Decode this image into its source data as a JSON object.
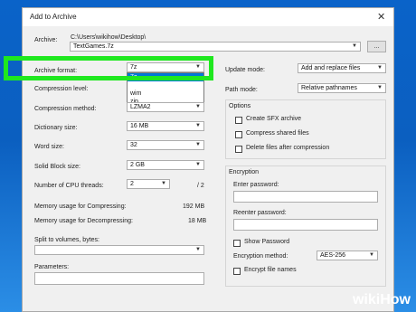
{
  "window": {
    "title": "Add to Archive",
    "close": "✕"
  },
  "archive": {
    "label": "Archive:",
    "path": "C:\\Users\\wikihow\\Desktop\\",
    "filename": "TextGames.7z",
    "browse": "..."
  },
  "left": {
    "archive_format": {
      "label": "Archive format:",
      "value": "7z"
    },
    "format_options": [
      "7z",
      "wim",
      "zip"
    ],
    "compression_level": {
      "label": "Compression level:"
    },
    "compression_method": {
      "label": "Compression method:",
      "value": "LZMA2"
    },
    "dictionary_size": {
      "label": "Dictionary size:",
      "value": "16 MB"
    },
    "word_size": {
      "label": "Word size:",
      "value": "32"
    },
    "solid_block": {
      "label": "Solid Block size:",
      "value": "2 GB"
    },
    "cpu_threads": {
      "label": "Number of CPU threads:",
      "value": "2",
      "max": "/ 2"
    },
    "mem_compress": {
      "label": "Memory usage for Compressing:",
      "value": "192 MB"
    },
    "mem_decompress": {
      "label": "Memory usage for Decompressing:",
      "value": "18 MB"
    },
    "split": {
      "label": "Split to volumes, bytes:"
    },
    "parameters": {
      "label": "Parameters:"
    }
  },
  "right": {
    "update_mode": {
      "label": "Update mode:",
      "value": "Add and replace files"
    },
    "path_mode": {
      "label": "Path mode:",
      "value": "Relative pathnames"
    },
    "options": {
      "title": "Options",
      "sfx": "Create SFX archive",
      "shared": "Compress shared files",
      "delete": "Delete files after compression"
    },
    "encryption": {
      "title": "Encryption",
      "enter": "Enter password:",
      "reenter": "Reenter password:",
      "show": "Show Password",
      "method_label": "Encryption method:",
      "method": "AES-256",
      "encrypt_names": "Encrypt file names"
    }
  },
  "watermark": {
    "wiki": "wiki",
    "how": "How"
  },
  "colors": {
    "highlight": "#1fe81f",
    "selection": "#0078d7",
    "desktop": "#0b5fc0"
  }
}
